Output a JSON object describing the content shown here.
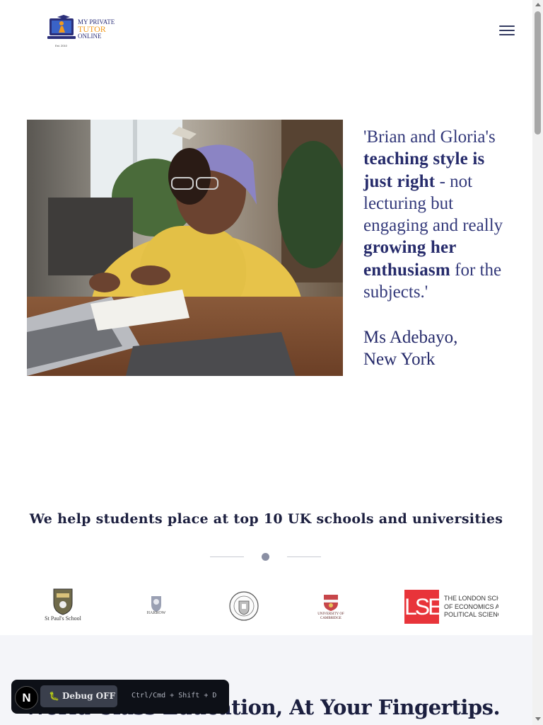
{
  "header": {
    "logo": {
      "line1": "MY PRIVATE",
      "line2": "TUTOR",
      "line3": "ONLINE",
      "est": "Est. 2010"
    },
    "menu_icon": "hamburger-menu-icon"
  },
  "hero": {
    "image": "girl-at-desk-with-laptop-photo"
  },
  "testimonial": {
    "q1": "'Brian and Gloria's ",
    "h1": "teaching style is just right",
    "q2": " - not lecturing but engaging and really ",
    "h2": "growing her enthusiasm",
    "q3": " for the subjects.'",
    "author_name": "Ms Adebayo,",
    "author_location": "New York"
  },
  "schools": {
    "title": "We help students place at top 10 UK schools and universities",
    "logos": [
      {
        "name": "St Paul's School"
      },
      {
        "name": "HARROW"
      },
      {
        "name": "University of Oxford"
      },
      {
        "name": "UNIVERSITY OF CAMBRIDGE"
      },
      {
        "name": "LSE",
        "line1": "THE LONDON SCHOOL",
        "line2": "OF ECONOMICS AND",
        "line3": "POLITICAL SCIENCE"
      }
    ]
  },
  "bottom": {
    "title": "World Class Education, At Your Fingertips."
  },
  "debug": {
    "badge": "N",
    "button_label": "Debug OFF",
    "shortcut": "Ctrl/Cmd + Shift + D"
  },
  "colors": {
    "brand_navy": "#262b6b",
    "brand_orange": "#f39a1c",
    "lse_red": "#e8343a"
  }
}
